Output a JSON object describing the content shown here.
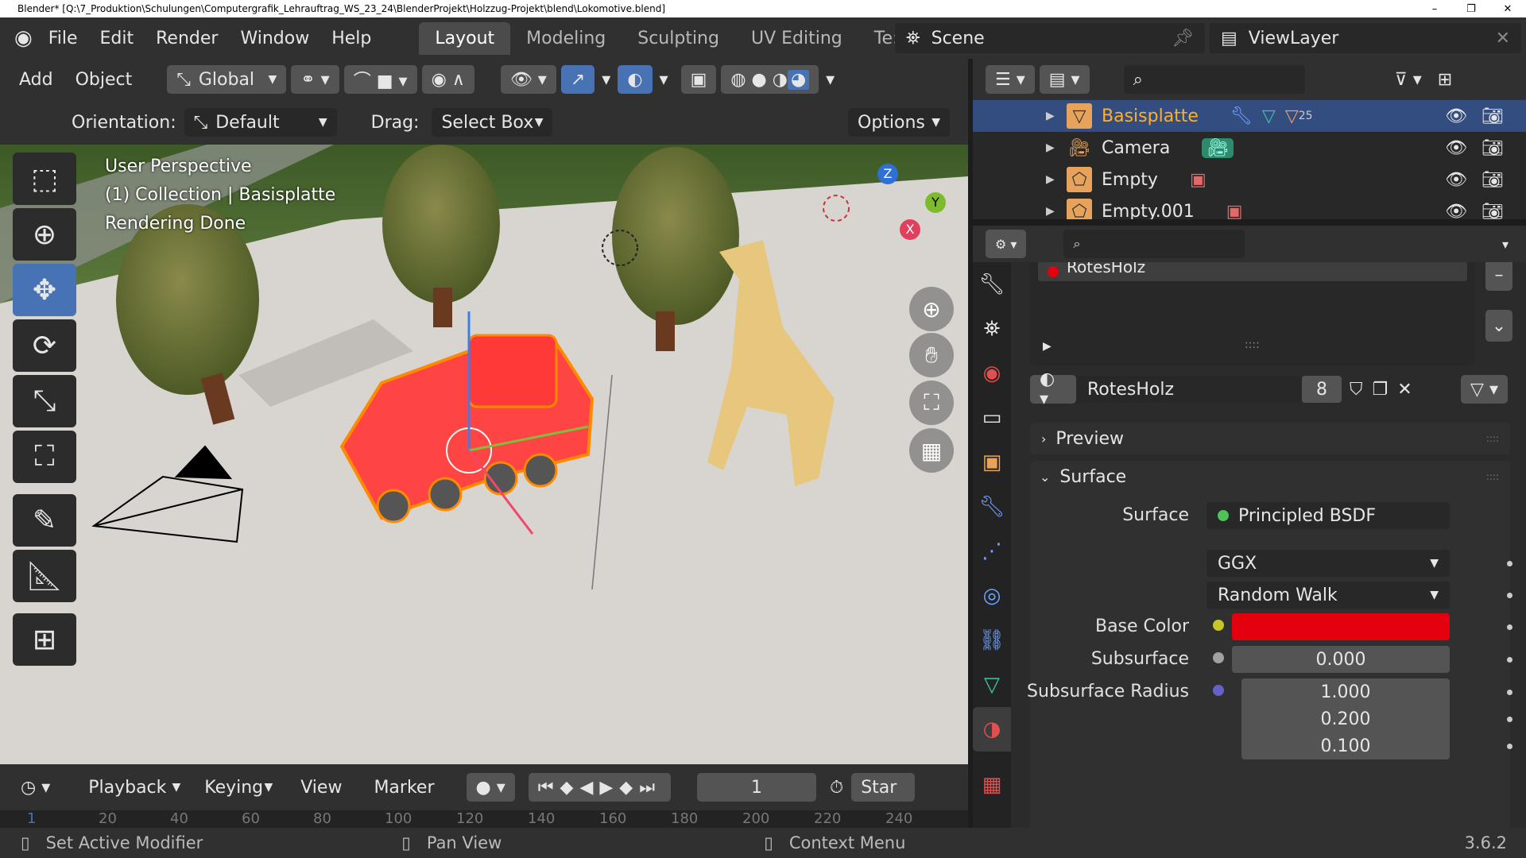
{
  "window": {
    "title": "Blender* [Q:\\7_Produktion\\Schulungen\\Computergrafik_Lehrauftrag_WS_23_24\\BlenderProjekt\\Holzzug-Projekt\\blend\\Lokomotive.blend]",
    "minimize": "–",
    "maximize": "❐",
    "close": "✕"
  },
  "menu": [
    "File",
    "Edit",
    "Render",
    "Window",
    "Help"
  ],
  "workspaces": [
    "Layout",
    "Modeling",
    "Sculpting",
    "UV Editing",
    "Te:"
  ],
  "scene": "Scene",
  "view_layer": "ViewLayer",
  "viewport_header": {
    "add": "Add",
    "object": "Object",
    "transform": "Global"
  },
  "viewport_header2": {
    "orientation_label": "Orientation:",
    "orientation": "Default",
    "drag_label": "Drag:",
    "drag": "Select Box",
    "options": "Options"
  },
  "overlay_text": [
    "User Perspective",
    "(1) Collection | Basisplatte",
    "Rendering Done"
  ],
  "gizmo": {
    "z": "Z",
    "y": "Y",
    "x": "X"
  },
  "timeline": {
    "playback": "Playback",
    "keying": "Keying",
    "view": "View",
    "marker": "Marker",
    "frame": "1",
    "start": "Star"
  },
  "scrub_ticks": [
    "1",
    "20",
    "40",
    "60",
    "80",
    "100",
    "120",
    "140",
    "160",
    "180",
    "200",
    "220",
    "240"
  ],
  "status": {
    "left": "Set Active Modifier",
    "middle": "Pan View",
    "right": "Context Menu",
    "version": "3.6.2"
  },
  "outliner": [
    {
      "name": "Basisplatte",
      "selected": true,
      "badge": "25",
      "icon": "mesh-icon"
    },
    {
      "name": "Camera",
      "selected": false,
      "icon": "camera-icon"
    },
    {
      "name": "Empty",
      "selected": false,
      "icon": "empty-icon"
    },
    {
      "name": "Empty.001",
      "selected": false,
      "icon": "empty-icon"
    }
  ],
  "properties": {
    "material_slot": "RotesHolz",
    "material_name": "RotesHolz",
    "users": "8",
    "preview_label": "Preview",
    "surface_panel": "Surface",
    "surface_label": "Surface",
    "surface_value": "Principled BSDF",
    "distribution": "GGX",
    "subsurface_method": "Random Walk",
    "base_color_label": "Base Color",
    "base_color": "#e3000f",
    "subsurface_label": "Subsurface",
    "subsurface_value": "0.000",
    "subsurface_radius_label": "Subsurface Radius",
    "radius": [
      "1.000",
      "0.200",
      "0.100"
    ]
  },
  "colors": {
    "accent": "#4772b3",
    "selected_text": "#ffaf29"
  }
}
